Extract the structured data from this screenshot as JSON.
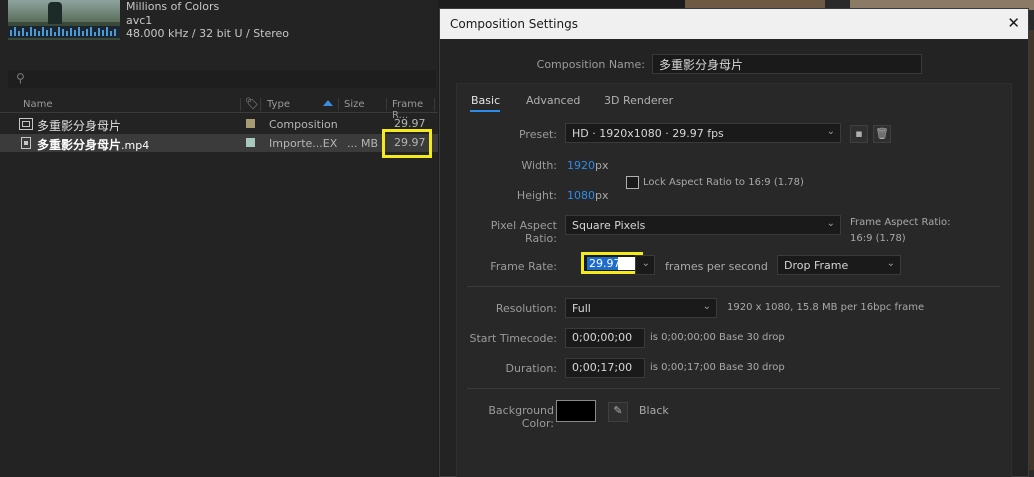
{
  "project": {
    "media_info": {
      "line1": "Millions of Colors",
      "line2": "avc1",
      "line3": "48.000 kHz / 32 bit U / Stereo"
    },
    "search_icon": "search-icon",
    "columns": {
      "name": "Name",
      "type": "Type",
      "size": "Size",
      "frame_rate": "Frame R..."
    },
    "rows": [
      {
        "name": "多重影分身母片",
        "ext": "",
        "type": "Composition",
        "size": "",
        "frame_rate": "29.97",
        "label_color": "#a89a72",
        "icon": "composition-icon"
      },
      {
        "name": "多重影分身母片",
        "ext": ".mp4",
        "type": "Importe...EX",
        "size": "... MB",
        "frame_rate": "29.97",
        "label_color": "#a8c8c0",
        "icon": "video-file-icon",
        "selected": true
      }
    ],
    "highlight_color": "#f5ea1b"
  },
  "dialog": {
    "title": "Composition Settings",
    "comp_name_label": "Composition Name:",
    "comp_name_value": "多重影分身母片",
    "tabs": [
      "Basic",
      "Advanced",
      "3D Renderer"
    ],
    "active_tab": "Basic",
    "preset_label": "Preset:",
    "preset_value": "HD  ·  1920x1080 · 29.97 fps",
    "width_label": "Width:",
    "width_value": "1920",
    "height_label": "Height:",
    "height_value": "1080",
    "px_unit": "px",
    "lock_aspect_label": "Lock Aspect Ratio to 16:9 (1.78)",
    "pixel_aspect_label": "Pixel Aspect Ratio:",
    "pixel_aspect_value": "Square Pixels",
    "frame_aspect_label": "Frame Aspect Ratio:",
    "frame_aspect_value": "16:9 (1.78)",
    "frame_rate_label": "Frame Rate:",
    "frame_rate_value": "29.97",
    "fps_label": "frames per second",
    "drop_frame_value": "Drop Frame",
    "resolution_label": "Resolution:",
    "resolution_value": "Full",
    "resolution_info": "1920 x 1080, 15.8 MB per 16bpc frame",
    "start_tc_label": "Start Timecode:",
    "start_tc_value": "0;00;00;00",
    "start_tc_info": "is 0;00;00;00  Base 30",
    "start_tc_drop": "drop",
    "duration_label": "Duration:",
    "duration_value": "0;00;17;00",
    "duration_info": "is 0;00;17;00  Base 30",
    "duration_drop": "drop",
    "bg_color_label": "Background Color:",
    "bg_color_name": "Black",
    "bg_color_hex": "#000000",
    "accent": "#2d8ceb"
  }
}
